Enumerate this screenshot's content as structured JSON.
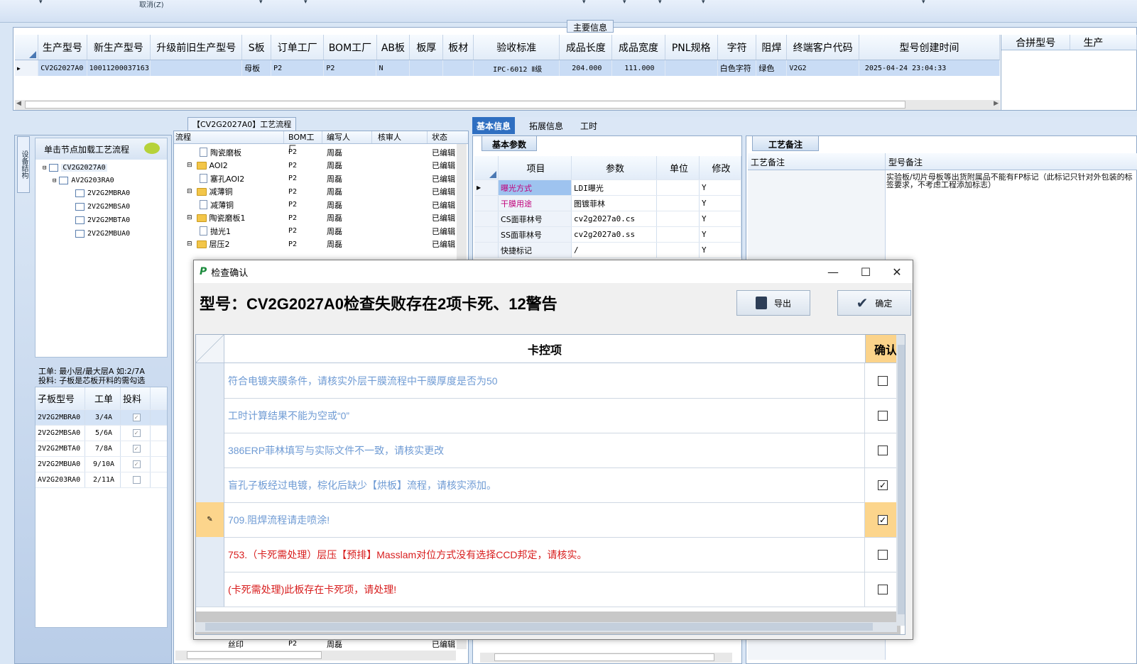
{
  "topbar": {
    "cancel_label": "取消(Z)"
  },
  "main_info": {
    "title": "主要信息",
    "columns": [
      "生产型号",
      "新生产型号",
      "升级前旧生产型号",
      "S板",
      "订单工厂",
      "BOM工厂",
      "AB板",
      "板厚",
      "板材",
      "验收标准",
      "成品长度",
      "成品宽度",
      "PNL规格",
      "字符",
      "阻焊",
      "终端客户代码",
      "型号创建时间"
    ],
    "row": [
      "CV2G2027A0",
      "10011200037163",
      "",
      "母板",
      "P2",
      "P2",
      "N",
      "",
      "",
      "IPC-6012 Ⅱ级",
      "204.000",
      "111.000",
      "",
      "白色字符",
      "绿色",
      "V2G2",
      "2025-04-24 23:04:33"
    ],
    "side_columns": [
      "合拼型号",
      "生产"
    ]
  },
  "left_panel": {
    "vertical_tab": "设备结构",
    "tree_header": "单击节点加载工艺流程",
    "tree": [
      "CV2G2027A0",
      "AV2G203RA0",
      "2V2G2MBRA0",
      "2V2G2MBSA0",
      "2V2G2MBTA0",
      "2V2G2MBUA0"
    ],
    "hint_line1": "工单: 最小层/最大层A 如:2/7A",
    "hint_line2": "投料: 子板是芯板开料的需勾选",
    "child_columns": [
      "子板型号",
      "工单",
      "投料"
    ],
    "child_rows": [
      {
        "model": "2V2G2MBRA0",
        "order": "3/4A",
        "feed": true
      },
      {
        "model": "2V2G2MBSA0",
        "order": "5/6A",
        "feed": true
      },
      {
        "model": "2V2G2MBTA0",
        "order": "7/8A",
        "feed": true
      },
      {
        "model": "2V2G2MBUA0",
        "order": "9/10A",
        "feed": true
      },
      {
        "model": "AV2G203RA0",
        "order": "2/11A",
        "feed": false
      }
    ]
  },
  "process": {
    "title": "【CV2G2027A0】工艺流程",
    "columns": [
      "流程",
      "BOM工厂",
      "编写人",
      "核审人",
      "状态"
    ],
    "rows": [
      {
        "name": "陶瓷磨板",
        "type": "doc",
        "indent": 2,
        "bom": "P2",
        "writer": "周磊",
        "reviewer": "",
        "status": "已编辑"
      },
      {
        "name": "AOI2",
        "type": "folder",
        "indent": 1,
        "bom": "P2",
        "writer": "周磊",
        "reviewer": "",
        "status": "已编辑"
      },
      {
        "name": "塞孔AOI2",
        "type": "doc",
        "indent": 2,
        "bom": "P2",
        "writer": "周磊",
        "reviewer": "",
        "status": "已编辑"
      },
      {
        "name": "减薄铜",
        "type": "folder",
        "indent": 1,
        "bom": "P2",
        "writer": "周磊",
        "reviewer": "",
        "status": "已编辑"
      },
      {
        "name": "减薄铜",
        "type": "doc",
        "indent": 2,
        "bom": "P2",
        "writer": "周磊",
        "reviewer": "",
        "status": "已编辑"
      },
      {
        "name": "陶瓷磨板1",
        "type": "folder",
        "indent": 1,
        "bom": "P2",
        "writer": "周磊",
        "reviewer": "",
        "status": "已编辑"
      },
      {
        "name": "抛光1",
        "type": "doc",
        "indent": 2,
        "bom": "P2",
        "writer": "周磊",
        "reviewer": "",
        "status": "已编辑"
      },
      {
        "name": "层压2",
        "type": "folder",
        "indent": 1,
        "bom": "P2",
        "writer": "周磊",
        "reviewer": "",
        "status": "已编辑"
      }
    ],
    "last_row": {
      "name": "丝印",
      "bom": "P2",
      "writer": "周磊",
      "status": "已编辑"
    }
  },
  "right_tabs": [
    "基本信息",
    "拓展信息",
    "工时"
  ],
  "params": {
    "tab": "基本参数",
    "columns": [
      "项目",
      "参数",
      "单位",
      "修改"
    ],
    "rows": [
      {
        "item": "曝光方式",
        "value": "LDI曝光",
        "unit": "",
        "edit": "Y"
      },
      {
        "item": "干膜用途",
        "value": "图镀菲林",
        "unit": "",
        "edit": "Y"
      },
      {
        "item": "CS面菲林号",
        "value": "cv2g2027a0.cs",
        "unit": "",
        "edit": "Y"
      },
      {
        "item": "SS面菲林号",
        "value": "cv2g2027a0.ss",
        "unit": "",
        "edit": "Y"
      },
      {
        "item": "快捷标记",
        "value": "/",
        "unit": "",
        "edit": "Y"
      }
    ],
    "colors": {
      "highlight_item": "#c0007a",
      "selected_bg": "#9ec3ef"
    }
  },
  "notes": {
    "tab": "工艺备注",
    "col_process": "工艺备注",
    "col_model": "型号备注",
    "model_note": "实验板/切片母板等出货附属品不能有FP标记（此标记只针对外包装的标签要求，不考虑工程添加标志）"
  },
  "dialog": {
    "title": "检查确认",
    "heading": "型号：CV2G2027A0检查失败存在2项卡死、12警告",
    "export_label": "导出",
    "confirm_label": "确定",
    "col_control": "卡控项",
    "col_confirm": "确认",
    "rows": [
      {
        "text": "符合电镀夹膜条件，请核实外层干膜流程中干膜厚度是否为50",
        "checked": false,
        "level": "warn"
      },
      {
        "text": "工时计算结果不能为空或“0”",
        "checked": false,
        "level": "warn"
      },
      {
        "text": "386ERP菲林填写与实际文件不一致，请核实更改",
        "checked": false,
        "level": "warn"
      },
      {
        "text": "盲孔子板经过电镀，棕化后缺少【烘板】流程，请核实添加。",
        "checked": true,
        "level": "warn"
      },
      {
        "text": "709.阻焊流程请走喷涂!",
        "checked": true,
        "level": "warn"
      },
      {
        "text": "753.（卡死需处理）层压【预排】Masslam对位方式没有选择CCD邦定，请核实。",
        "checked": false,
        "level": "block"
      },
      {
        "text": "(卡死需处理)此板存在卡死项，请处理!",
        "checked": false,
        "level": "block"
      }
    ],
    "colors": {
      "warn_text": "#6f9bd4",
      "block_text": "#d81e1e",
      "selected_row": "#fcd58c"
    }
  }
}
